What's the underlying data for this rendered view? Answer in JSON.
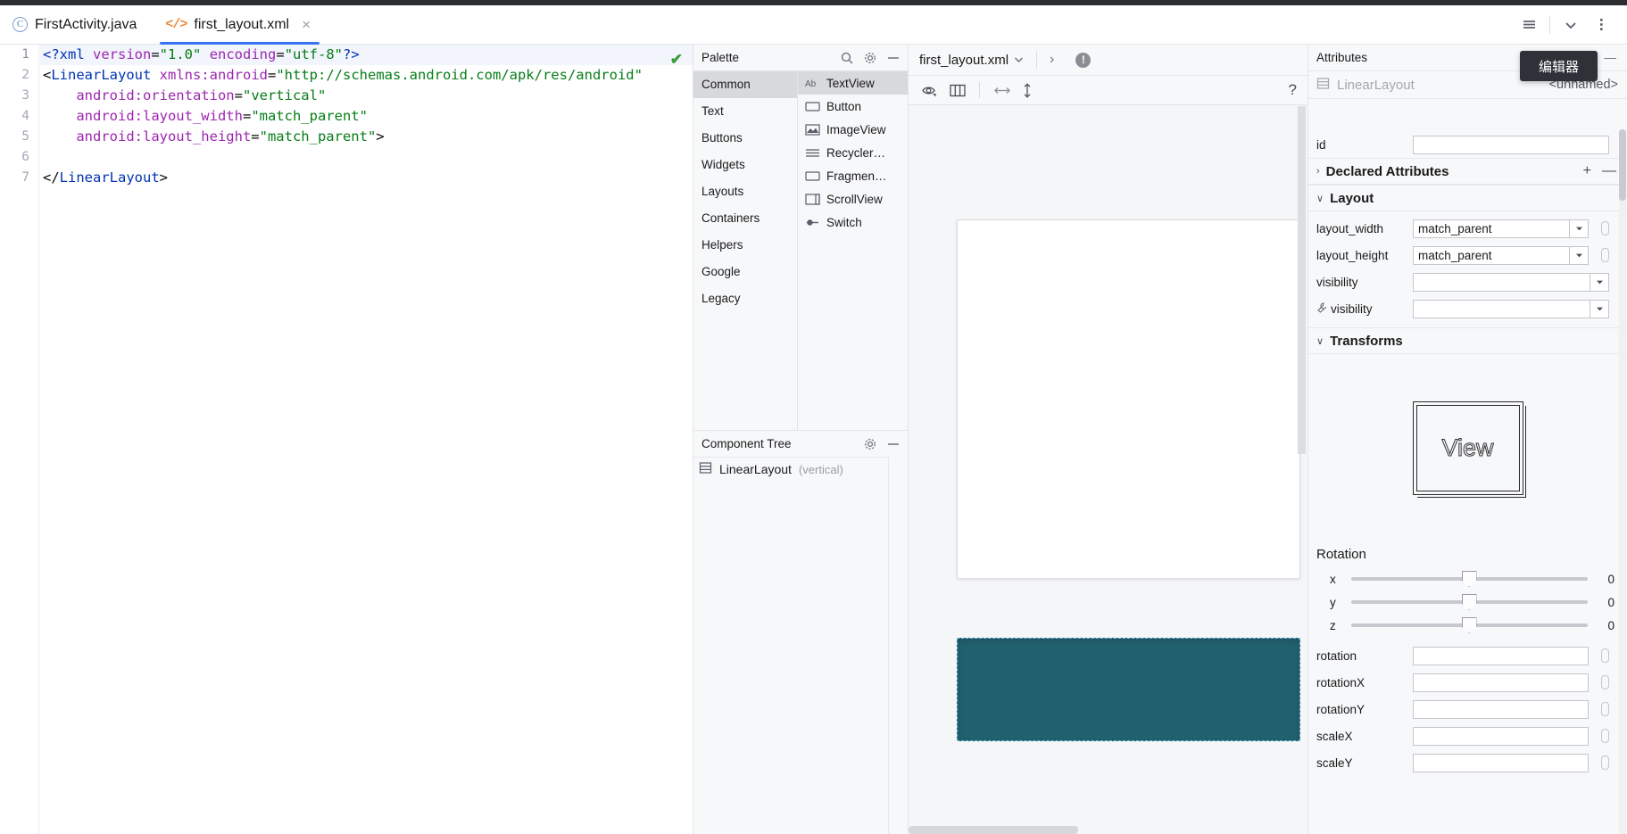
{
  "window": {
    "tabs": [
      {
        "label": "FirstActivity.java",
        "icon": "java-class-icon",
        "active": false,
        "closable": false
      },
      {
        "label": "first_layout.xml",
        "icon": "xml-file-icon",
        "active": true,
        "closable": true,
        "close_label": "×"
      }
    ],
    "toolbar_right": [
      {
        "name": "list-view-icon",
        "glyph": "☰"
      },
      {
        "name": "chevron-down-icon",
        "glyph": "∨"
      },
      {
        "name": "more-options-icon",
        "glyph": "⋮"
      }
    ]
  },
  "tooltip": {
    "text": "编辑器"
  },
  "editor": {
    "inspection_status": "✔",
    "lines": [
      {
        "num": "1",
        "current": true,
        "tokens": [
          {
            "t": "<?xml ",
            "c": "tag"
          },
          {
            "t": "version",
            "c": "attr"
          },
          {
            "t": "=",
            "c": "punct"
          },
          {
            "t": "\"1.0\"",
            "c": "str"
          },
          {
            "t": " ",
            "c": "punct"
          },
          {
            "t": "encoding",
            "c": "attr"
          },
          {
            "t": "=",
            "c": "punct"
          },
          {
            "t": "\"utf-8\"",
            "c": "str"
          },
          {
            "t": "?>",
            "c": "tag"
          }
        ]
      },
      {
        "num": "2",
        "current": false,
        "tokens": [
          {
            "t": "<",
            "c": "punct"
          },
          {
            "t": "LinearLayout",
            "c": "tag"
          },
          {
            "t": " ",
            "c": "punct"
          },
          {
            "t": "xmlns:android",
            "c": "attr"
          },
          {
            "t": "=",
            "c": "punct"
          },
          {
            "t": "\"http://schemas.android.com/apk/res/android\"",
            "c": "str"
          }
        ]
      },
      {
        "num": "3",
        "current": false,
        "tokens": [
          {
            "t": "    ",
            "c": "punct"
          },
          {
            "t": "android:orientation",
            "c": "attr"
          },
          {
            "t": "=",
            "c": "punct"
          },
          {
            "t": "\"vertical\"",
            "c": "str"
          }
        ]
      },
      {
        "num": "4",
        "current": false,
        "tokens": [
          {
            "t": "    ",
            "c": "punct"
          },
          {
            "t": "android:layout_width",
            "c": "attr"
          },
          {
            "t": "=",
            "c": "punct"
          },
          {
            "t": "\"match_parent\"",
            "c": "str"
          }
        ]
      },
      {
        "num": "5",
        "current": false,
        "tokens": [
          {
            "t": "    ",
            "c": "punct"
          },
          {
            "t": "android:layout_height",
            "c": "attr"
          },
          {
            "t": "=",
            "c": "punct"
          },
          {
            "t": "\"match_parent\"",
            "c": "str"
          },
          {
            "t": ">",
            "c": "punct"
          }
        ]
      },
      {
        "num": "6",
        "current": false,
        "tokens": []
      },
      {
        "num": "7",
        "current": false,
        "tokens": [
          {
            "t": "</",
            "c": "punct"
          },
          {
            "t": "LinearLayout",
            "c": "tag"
          },
          {
            "t": ">",
            "c": "punct"
          }
        ]
      }
    ]
  },
  "palette": {
    "title": "Palette",
    "actions": [
      {
        "name": "search-icon"
      },
      {
        "name": "gear-icon"
      },
      {
        "name": "minimize-icon"
      }
    ],
    "categories": [
      {
        "label": "Common",
        "selected": true
      },
      {
        "label": "Text",
        "selected": false
      },
      {
        "label": "Buttons",
        "selected": false
      },
      {
        "label": "Widgets",
        "selected": false
      },
      {
        "label": "Layouts",
        "selected": false
      },
      {
        "label": "Containers",
        "selected": false
      },
      {
        "label": "Helpers",
        "selected": false
      },
      {
        "label": "Google",
        "selected": false
      },
      {
        "label": "Legacy",
        "selected": false
      }
    ],
    "items": [
      {
        "label": "TextView",
        "icon": "textview-icon",
        "glyph": "Ab",
        "selected": true
      },
      {
        "label": "Button",
        "icon": "button-icon",
        "glyph": "▭",
        "selected": false
      },
      {
        "label": "ImageView",
        "icon": "imageview-icon",
        "glyph": "❑",
        "selected": false
      },
      {
        "label": "Recycler…",
        "icon": "recyclerview-icon",
        "glyph": "☰",
        "selected": false
      },
      {
        "label": "Fragmen…",
        "icon": "fragment-icon",
        "glyph": "▭",
        "selected": false
      },
      {
        "label": "ScrollView",
        "icon": "scrollview-icon",
        "glyph": "▤",
        "selected": false
      },
      {
        "label": "Switch",
        "icon": "switch-icon",
        "glyph": "⚬",
        "selected": false
      }
    ]
  },
  "component_tree": {
    "title": "Component Tree",
    "actions": [
      {
        "name": "gear-icon"
      },
      {
        "name": "minimize-icon"
      }
    ],
    "nodes": [
      {
        "icon": "linearlayout-icon",
        "label": "LinearLayout",
        "suffix": "(vertical)"
      }
    ]
  },
  "design": {
    "file_name": "first_layout.xml",
    "file_dropdown_glyph": "∨",
    "next_glyph": "›",
    "warning_glyph": "!",
    "tools": [
      {
        "name": "design-mode-icon",
        "glyph": "◎"
      },
      {
        "name": "layout-columns-icon",
        "glyph": "⫴"
      },
      {
        "name": "horizontal-resize-icon",
        "glyph": "↔"
      },
      {
        "name": "vertical-resize-icon",
        "glyph": "↕"
      }
    ],
    "help_glyph": "?",
    "preview_bg": "#ffffff",
    "accent_teal": "#21606e"
  },
  "attributes": {
    "title": "Attributes",
    "minimize_glyph": "—",
    "component_name": "LinearLayout",
    "component_id_value": "<unnamed>",
    "rows_top": [
      {
        "label": "id",
        "value": "",
        "name": "id-field",
        "dropdown": false,
        "pill": false
      }
    ],
    "sections": [
      {
        "name": "declared-attributes",
        "title": "Declared Attributes",
        "caret": "›",
        "expanded": false,
        "actions": [
          {
            "name": "add-attribute-button",
            "glyph": "+"
          },
          {
            "name": "remove-attribute-button",
            "glyph": "—"
          }
        ]
      },
      {
        "name": "layout",
        "title": "Layout",
        "caret": "∨",
        "expanded": true,
        "actions": []
      }
    ],
    "layout_rows": [
      {
        "label": "layout_width",
        "value": "match_parent",
        "dropdown": true,
        "pill": true,
        "wrench": false
      },
      {
        "label": "layout_height",
        "value": "match_parent",
        "dropdown": true,
        "pill": true,
        "wrench": false
      },
      {
        "label": "visibility",
        "value": "",
        "dropdown": true,
        "pill": false,
        "wrench": false
      },
      {
        "label": "visibility",
        "value": "",
        "dropdown": true,
        "pill": false,
        "wrench": true
      }
    ],
    "transforms_section": {
      "name": "transforms",
      "title": "Transforms",
      "caret": "∨"
    },
    "view_box_label": "View",
    "rotation_title": "Rotation",
    "rotation_sliders": [
      {
        "axis": "x",
        "value": "0",
        "position": 50
      },
      {
        "axis": "y",
        "value": "0",
        "position": 50
      },
      {
        "axis": "z",
        "value": "0",
        "position": 50
      }
    ],
    "transform_rows": [
      {
        "label": "rotation",
        "value": "",
        "pill": true
      },
      {
        "label": "rotationX",
        "value": "",
        "pill": true
      },
      {
        "label": "rotationY",
        "value": "",
        "pill": true
      },
      {
        "label": "scaleX",
        "value": "",
        "pill": true
      },
      {
        "label": "scaleY",
        "value": "",
        "pill": true
      }
    ]
  }
}
